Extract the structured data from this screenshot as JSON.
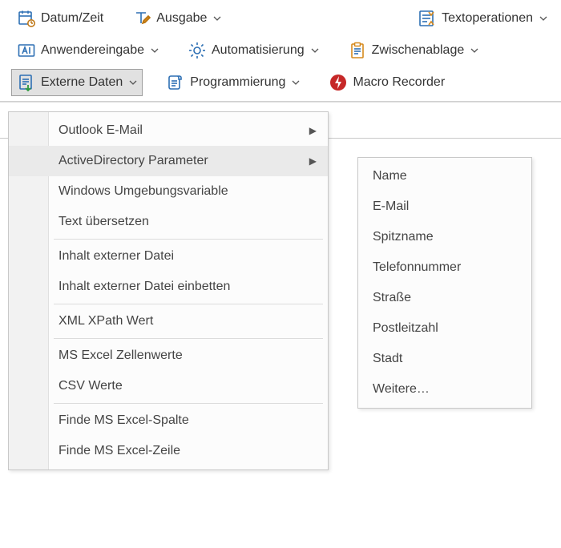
{
  "ribbon": {
    "row1": {
      "datetime": "Datum/Zeit",
      "output": "Ausgabe",
      "textops": "Textoperationen"
    },
    "row2": {
      "userinput": "Anwendereingabe",
      "automation": "Automatisierung",
      "clipboard": "Zwischenablage"
    },
    "row3": {
      "externaldata": "Externe Daten",
      "programming": "Programmierung",
      "macrorecorder": "Macro Recorder"
    }
  },
  "menu_main": {
    "items": [
      {
        "label": "Outlook E-Mail",
        "hasSub": true
      },
      {
        "label": "ActiveDirectory Parameter",
        "hasSub": true,
        "highlight": true
      },
      {
        "label": "Windows Umgebungsvariable"
      },
      {
        "label": "Text übersetzen"
      },
      {
        "sep": true
      },
      {
        "label": "Inhalt externer Datei"
      },
      {
        "label": "Inhalt externer Datei einbetten"
      },
      {
        "sep": true
      },
      {
        "label": "XML XPath Wert"
      },
      {
        "sep": true
      },
      {
        "label": "MS Excel Zellenwerte"
      },
      {
        "label": "CSV Werte"
      },
      {
        "sep": true
      },
      {
        "label": "Finde MS Excel-Spalte"
      },
      {
        "label": "Finde MS Excel-Zeile"
      }
    ]
  },
  "menu_sub": {
    "items": [
      {
        "label": "Name"
      },
      {
        "label": "E-Mail"
      },
      {
        "label": "Spitzname"
      },
      {
        "label": "Telefonnummer"
      },
      {
        "label": "Straße"
      },
      {
        "label": "Postleitzahl"
      },
      {
        "label": "Stadt"
      },
      {
        "label": "Weitere…"
      }
    ]
  }
}
